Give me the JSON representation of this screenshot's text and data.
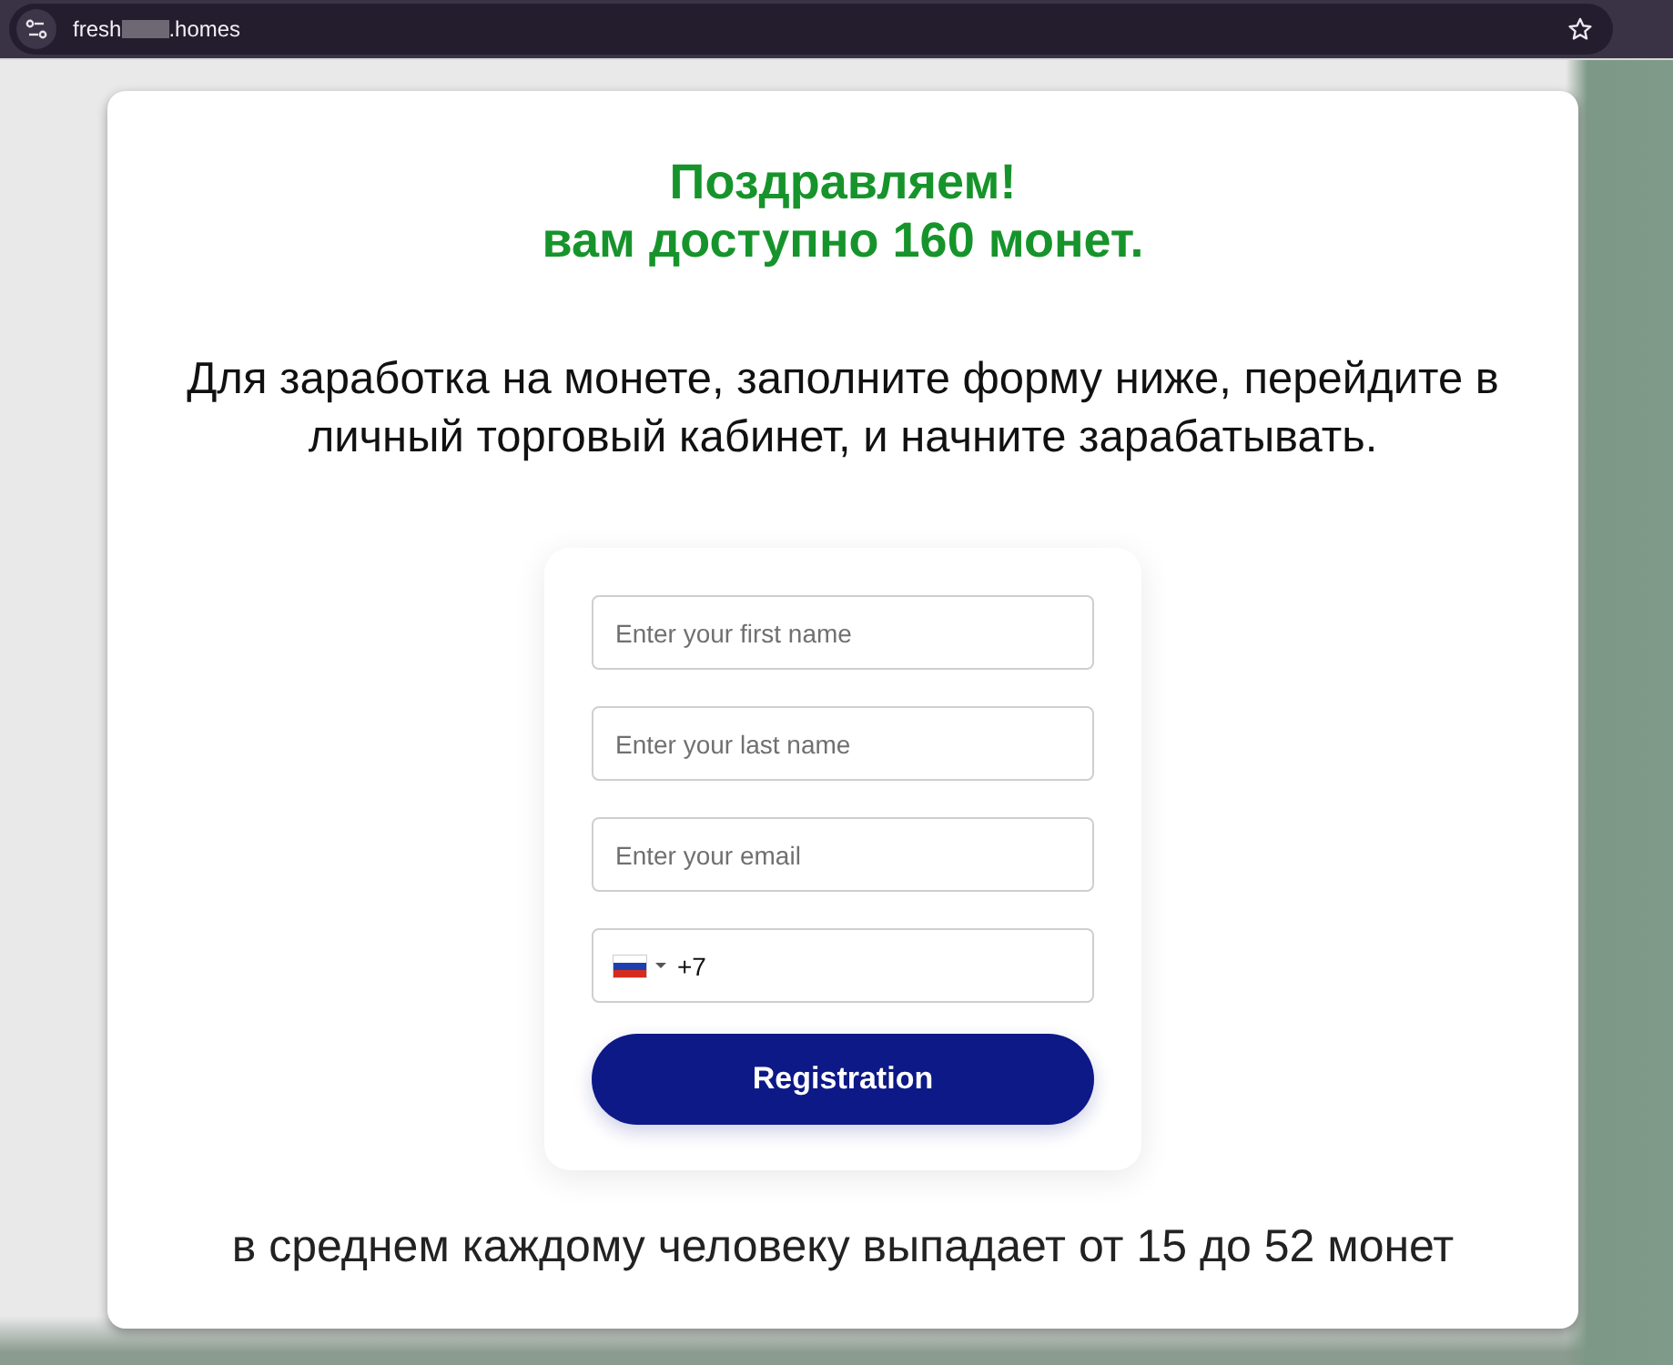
{
  "browser": {
    "url_start": "fresh",
    "url_end": ".homes"
  },
  "modal": {
    "heading_lines": [
      "Поздравляем!",
      "вам доступно 160 монет."
    ],
    "intro": "Для заработка на монете, заполните форму ниже, перейдите в личный торговый кабинет, и начните зарабатывать.",
    "form": {
      "fields": [
        {
          "kind": "text",
          "placeholder": "Enter your first name"
        },
        {
          "kind": "text",
          "placeholder": "Enter your last name"
        },
        {
          "kind": "email",
          "placeholder": "Enter your email"
        },
        {
          "kind": "phone",
          "value": "+7"
        }
      ],
      "submit_button": "Registration"
    },
    "footnote": "в среднем каждому человеку выпадает от 15 до 52 монет"
  }
}
